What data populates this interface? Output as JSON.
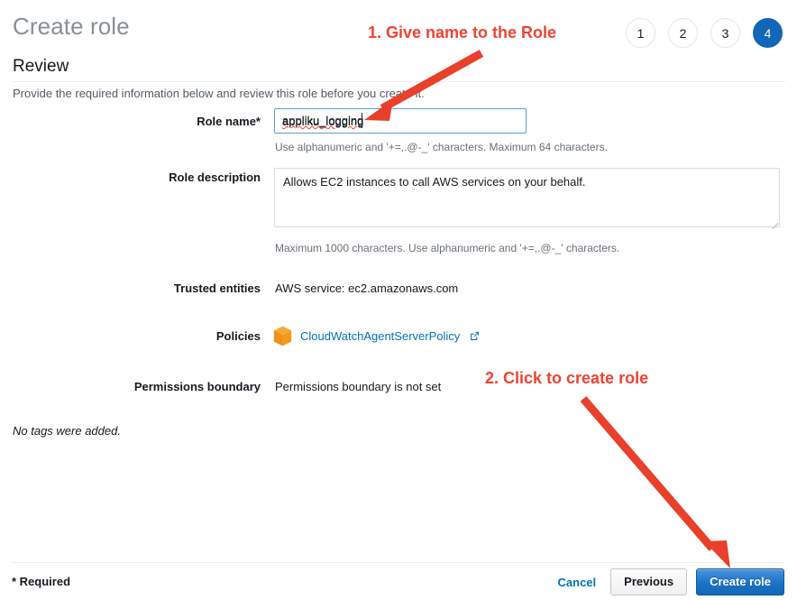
{
  "header": {
    "title": "Create role",
    "steps": [
      {
        "label": "1",
        "active": false
      },
      {
        "label": "2",
        "active": false
      },
      {
        "label": "3",
        "active": false
      },
      {
        "label": "4",
        "active": true
      }
    ]
  },
  "section": {
    "title": "Review",
    "intro": "Provide the required information below and review this role before you create it."
  },
  "form": {
    "role_name": {
      "label": "Role name*",
      "value": "appliku_logging",
      "placeholder": "",
      "hint": "Use alphanumeric and '+=,.@-_' characters. Maximum 64 characters."
    },
    "role_description": {
      "label": "Role description",
      "value": "Allows EC2 instances to call AWS services on your behalf.",
      "placeholder": "",
      "hint": "Maximum 1000 characters. Use alphanumeric and '+=,.@-_' characters."
    },
    "trusted_entities": {
      "label": "Trusted entities",
      "value": "AWS service: ec2.amazonaws.com"
    },
    "policies": {
      "label": "Policies",
      "icon": "policy-cube-icon",
      "link_text": "CloudWatchAgentServerPolicy",
      "external_icon": "external-link-icon"
    },
    "permissions_boundary": {
      "label": "Permissions boundary",
      "value": "Permissions boundary is not set"
    },
    "tags_note": "No tags were added."
  },
  "footer": {
    "required_note": "* Required",
    "cancel_label": "Cancel",
    "previous_label": "Previous",
    "create_label": "Create role"
  },
  "annotations": [
    {
      "text": "1. Give name to the Role"
    },
    {
      "text": "2. Click to create role"
    }
  ],
  "colors": {
    "accent_blue": "#0073bb",
    "primary_button": "#1a73c4",
    "step_active": "#1266b8",
    "annotation_red": "#f04332",
    "policy_orange": "#f59b1c",
    "focus_border": "#5b9dd9",
    "spellcheck_red": "#e8452c"
  }
}
